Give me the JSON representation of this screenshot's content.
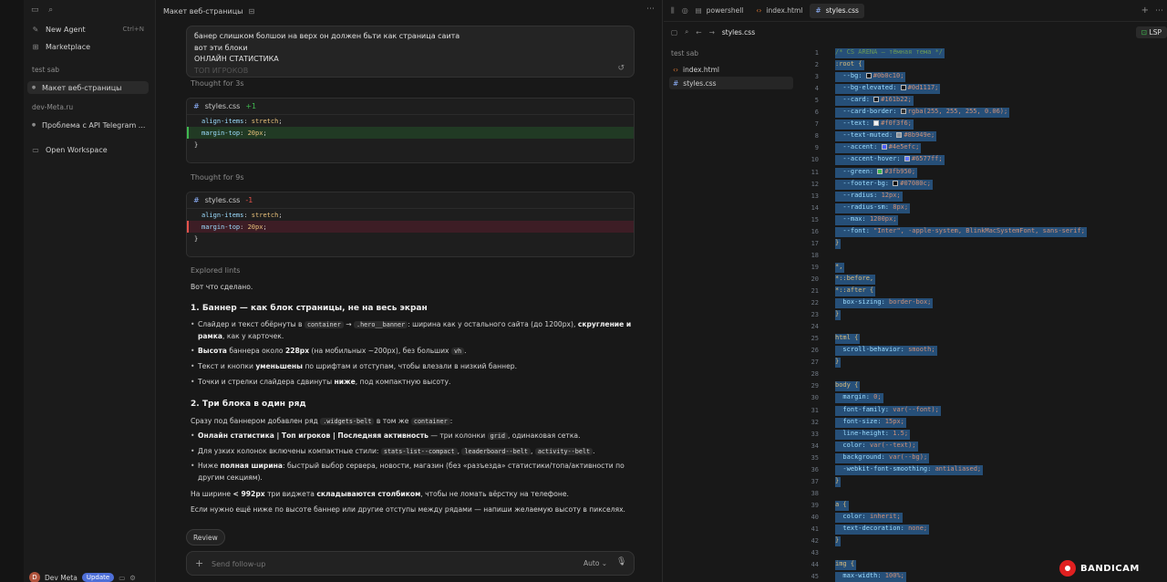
{
  "sidebar": {
    "new_agent": "New Agent",
    "new_agent_shortcut": "Ctrl+N",
    "marketplace": "Marketplace",
    "section_test_sab": "test sab",
    "chat_active": "Макет веб-страницы",
    "section_dev_meta": "dev-Meta.ru",
    "chat_other": "Проблема с API Telegram ...",
    "open_workspace": "Open Workspace",
    "user_name": "Dev Meta",
    "update_label": "Update"
  },
  "chat": {
    "title": "Макет веб-страницы",
    "user_message": [
      "банер слишком болшои на верх он должен бьти как страница саита",
      "вот эти блоки",
      "ОНЛАЙН СТАТИСТИКА",
      "ТОП ИГРОКОВ"
    ],
    "thought1": "Thought for 3s",
    "diff1": {
      "file": "styles.css",
      "count": "+1",
      "line1_prop": "align-items",
      "line1_val": "stretch",
      "line2_prop": "margin-top",
      "line2_val": "20px",
      "line3": "}"
    },
    "thought2": "Thought for 9s",
    "diff2": {
      "file": "styles.css",
      "count": "-1",
      "line1_prop": "align-items",
      "line1_val": "stretch",
      "line2_prop": "margin-top",
      "line2_val": "20px",
      "line3": "}"
    },
    "explored": "Explored lints",
    "done": "Вот что сделано.",
    "h1": "1. Баннер — как блок страницы, не на весь экран",
    "b1": {
      "t1": "Слайдер и текст обёрнуты в ",
      "c1": "container",
      "t2": " → ",
      "c2": ".hero__banner",
      "t3": ": ширина как у остального сайта (до 1200px), ",
      "s1": "скругление и рамка",
      "t4": ", как у карточек."
    },
    "b2": {
      "s1": "Высота",
      "t1": " баннера около ",
      "s2": "228px",
      "t2": " (на мобильных ~200px), без больших ",
      "c1": "vh",
      "t3": "."
    },
    "b3": {
      "t1": "Текст и кнопки ",
      "s1": "уменьшены",
      "t2": " по шрифтам и отступам, чтобы влезали в низкий баннер."
    },
    "b4": {
      "t1": "Точки и стрелки слайдера сдвинуты ",
      "s1": "ниже",
      "t2": ", под компактную высоту."
    },
    "h2": "2. Три блока в один ряд",
    "p2": {
      "t1": "Сразу под баннером добавлен ряд ",
      "c1": ".widgets-belt",
      "t2": " в том же ",
      "c2": "container",
      "t3": ":"
    },
    "b5": {
      "s1": "Онлайн статистика | Топ игроков | Последняя активность",
      "t1": " — три колонки ",
      "c1": "grid",
      "t2": ", одинаковая сетка."
    },
    "b6": {
      "t1": "Для узких колонок включены компактные стили: ",
      "c1": "stats-list--compact",
      "t2": ", ",
      "c2": "leaderboard--belt",
      "t3": ", ",
      "c3": "activity--belt",
      "t4": "."
    },
    "b7": {
      "t1": "Ниже ",
      "s1": "полная ширина",
      "t2": ": быстрый выбор сервера, новости, магазин (без «разъезда» статистики/топа/активности по другим секциям)."
    },
    "p3": {
      "t1": "На ширине ",
      "s1": "< 992px",
      "t2": " три виджета ",
      "s2": "складываются столбиком",
      "t3": ", чтобы не ломать вёрстку на телефоне."
    },
    "p4": "Если нужно ещё ниже по высоте баннер или другие отступы между рядами — напиши желаемую высоту в пикселях.",
    "review": "Review",
    "input_placeholder": "Send follow-up",
    "model": "Auto"
  },
  "editor": {
    "tabs": [
      "powershell",
      "index.html",
      "styles.css"
    ],
    "active_tab": "styles.css",
    "breadcrumb": "styles.css",
    "lsp": "LSP",
    "explorer_root": "test sab",
    "files": [
      "index.html",
      "styles.css"
    ],
    "code_lines": [
      {
        "n": "1",
        "t": "/* CS ARENA — тёмная тема */",
        "k": "cmt"
      },
      {
        "n": "2",
        "t": ":root {",
        "k": "sel"
      },
      {
        "n": "3",
        "t": "  --bg: #0b0c10;",
        "k": "var",
        "sw": "#0b0c10"
      },
      {
        "n": "4",
        "t": "  --bg-elevated: #0d1117;",
        "k": "var",
        "sw": "#0d1117"
      },
      {
        "n": "5",
        "t": "  --card: #161b22;",
        "k": "var",
        "sw": "#161b22"
      },
      {
        "n": "6",
        "t": "  --card-border: rgba(255, 255, 255, 0.06);",
        "k": "var",
        "sw": "#333333"
      },
      {
        "n": "7",
        "t": "  --text: #f0f3f6;",
        "k": "var",
        "sw": "#f0f3f6"
      },
      {
        "n": "8",
        "t": "  --text-muted: #8b949e;",
        "k": "var",
        "sw": "#8b949e"
      },
      {
        "n": "9",
        "t": "  --accent: #4e5efc;",
        "k": "var",
        "sw": "#4e5efc"
      },
      {
        "n": "10",
        "t": "  --accent-hover: #6577ff;",
        "k": "var",
        "sw": "#6577ff"
      },
      {
        "n": "11",
        "t": "  --green: #3fb950;",
        "k": "var",
        "sw": "#3fb950"
      },
      {
        "n": "12",
        "t": "  --footer-bg: #07080c;",
        "k": "var",
        "sw": "#07080c"
      },
      {
        "n": "13",
        "t": "  --radius: 12px;",
        "k": "var"
      },
      {
        "n": "14",
        "t": "  --radius-sm: 8px;",
        "k": "var"
      },
      {
        "n": "15",
        "t": "  --max: 1200px;",
        "k": "var"
      },
      {
        "n": "16",
        "t": "  --font: \"Inter\", -apple-system, BlinkMacSystemFont, sans-serif;",
        "k": "var"
      },
      {
        "n": "17",
        "t": "}",
        "k": "sel"
      },
      {
        "n": "18",
        "t": "",
        "k": "blank"
      },
      {
        "n": "19",
        "t": "*,",
        "k": "sel"
      },
      {
        "n": "20",
        "t": "*::before,",
        "k": "sel"
      },
      {
        "n": "21",
        "t": "*::after {",
        "k": "sel"
      },
      {
        "n": "22",
        "t": "  box-sizing: border-box;",
        "k": "var"
      },
      {
        "n": "23",
        "t": "}",
        "k": "sel"
      },
      {
        "n": "24",
        "t": "",
        "k": "blank"
      },
      {
        "n": "25",
        "t": "html {",
        "k": "sel"
      },
      {
        "n": "26",
        "t": "  scroll-behavior: smooth;",
        "k": "var"
      },
      {
        "n": "27",
        "t": "}",
        "k": "sel"
      },
      {
        "n": "28",
        "t": "",
        "k": "blank"
      },
      {
        "n": "29",
        "t": "body {",
        "k": "sel"
      },
      {
        "n": "30",
        "t": "  margin: 0;",
        "k": "var"
      },
      {
        "n": "31",
        "t": "  font-family: var(--font);",
        "k": "var"
      },
      {
        "n": "32",
        "t": "  font-size: 15px;",
        "k": "var"
      },
      {
        "n": "33",
        "t": "  line-height: 1.5;",
        "k": "var"
      },
      {
        "n": "34",
        "t": "  color: var(--text);",
        "k": "var"
      },
      {
        "n": "35",
        "t": "  background: var(--bg);",
        "k": "var"
      },
      {
        "n": "36",
        "t": "  -webkit-font-smoothing: antialiased;",
        "k": "var"
      },
      {
        "n": "37",
        "t": "}",
        "k": "sel"
      },
      {
        "n": "38",
        "t": "",
        "k": "blank"
      },
      {
        "n": "39",
        "t": "a {",
        "k": "sel"
      },
      {
        "n": "40",
        "t": "  color: inherit;",
        "k": "var"
      },
      {
        "n": "41",
        "t": "  text-decoration: none;",
        "k": "var"
      },
      {
        "n": "42",
        "t": "}",
        "k": "sel"
      },
      {
        "n": "43",
        "t": "",
        "k": "blank"
      },
      {
        "n": "44",
        "t": "img {",
        "k": "sel"
      },
      {
        "n": "45",
        "t": "  max-width: 100%;",
        "k": "var"
      }
    ]
  },
  "watermark": "BANDICAM"
}
